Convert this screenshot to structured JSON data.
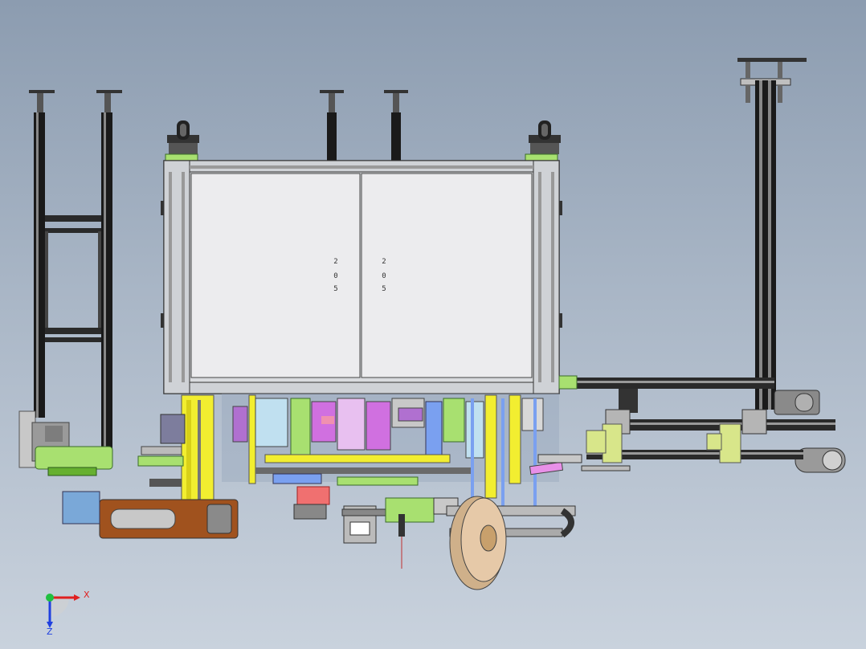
{
  "viewport": {
    "background_top": "#8c9cb0",
    "background_bottom": "#c9d2dd"
  },
  "triad": {
    "x_label": "X",
    "z_label": "Z",
    "x_color": "#e02020",
    "y_color": "#20c040",
    "z_color": "#2040e0"
  },
  "cabinet": {
    "left_door_handle": [
      "2",
      "0",
      "5"
    ],
    "right_door_handle": [
      "2",
      "0",
      "5"
    ]
  },
  "colors": {
    "frame_black": "#1a1a1a",
    "cabinet_panel": "#e8e8ea",
    "accent_yellow": "#f2ee30",
    "accent_green": "#a8e070",
    "accent_brown": "#a0521e",
    "accent_magenta": "#d070e0",
    "accent_blue": "#7aa0f0",
    "disc_tan": "#e6c9a8"
  },
  "icons": {
    "axis_triad": "view-orientation-triad-icon"
  }
}
